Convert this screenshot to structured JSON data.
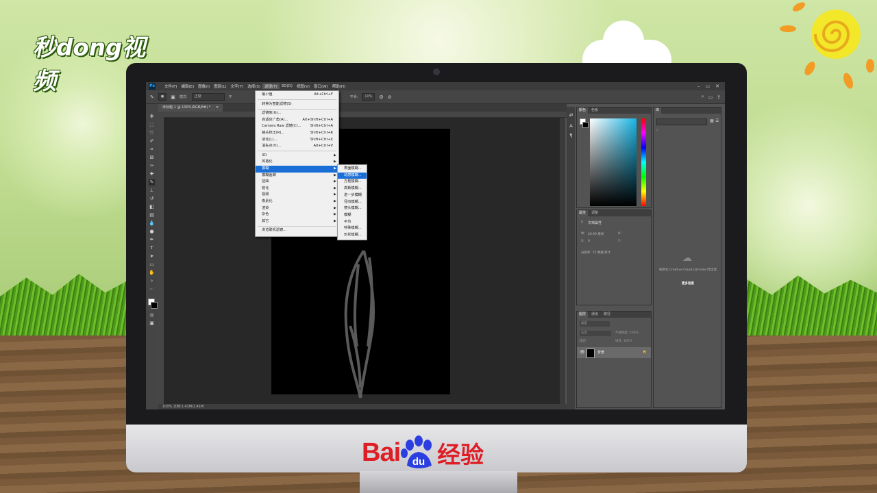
{
  "watermark_logo": "秒dong视频",
  "footer_logo": {
    "bai": "Bai",
    "du": "du",
    "jingyan": "经验",
    "brand_color": "#de1d24"
  },
  "app": {
    "badge": "Ps",
    "menu": [
      "文件(F)",
      "编辑(E)",
      "图像(I)",
      "图层(L)",
      "文字(Y)",
      "选择(S)",
      "滤镜(T)",
      "3D(D)",
      "视图(V)",
      "窗口(W)",
      "帮助(H)"
    ],
    "active_menu_index": 6,
    "window_controls": [
      "–",
      "▭",
      "✕"
    ]
  },
  "options_bar": {
    "mode_label": "模式:",
    "mode_value": "正常",
    "opacity_label": "不",
    "flow_label": "平滑:",
    "flow_value": "10%"
  },
  "document": {
    "tab_title": "未标题-1 @ 100%(RGB/8#) *",
    "tab_close": "×",
    "status": "100%    文档:1.41M/1.41M"
  },
  "filter_menu": {
    "items": [
      {
        "label": "最小值",
        "shortcut": "Alt+Ctrl+F"
      },
      {
        "separator": true
      },
      {
        "label": "转换为智能滤镜(S)"
      },
      {
        "separator": true
      },
      {
        "label": "滤镜库(G)..."
      },
      {
        "label": "自适应广角(A)...",
        "shortcut": "Alt+Shift+Ctrl+A"
      },
      {
        "label": "Camera Raw 滤镜(C)...",
        "shortcut": "Shift+Ctrl+A"
      },
      {
        "label": "镜头校正(R)...",
        "shortcut": "Shift+Ctrl+R"
      },
      {
        "label": "液化(L)...",
        "shortcut": "Shift+Ctrl+X"
      },
      {
        "label": "消失点(V)...",
        "shortcut": "Alt+Ctrl+V"
      },
      {
        "separator": true
      },
      {
        "label": "3D",
        "submenu": true
      },
      {
        "label": "风格化",
        "submenu": true
      },
      {
        "label": "模糊",
        "submenu": true,
        "highlighted": true
      },
      {
        "label": "模糊画廊",
        "submenu": true
      },
      {
        "label": "扭曲",
        "submenu": true
      },
      {
        "label": "锐化",
        "submenu": true
      },
      {
        "label": "视频",
        "submenu": true
      },
      {
        "label": "像素化",
        "submenu": true
      },
      {
        "label": "渲染",
        "submenu": true
      },
      {
        "label": "杂色",
        "submenu": true
      },
      {
        "label": "其它",
        "submenu": true
      },
      {
        "separator": true
      },
      {
        "label": "浏览联机滤镜..."
      }
    ]
  },
  "blur_submenu": {
    "items": [
      {
        "label": "表面模糊..."
      },
      {
        "label": "动感模糊...",
        "highlighted": true
      },
      {
        "label": "方框模糊..."
      },
      {
        "label": "高斯模糊..."
      },
      {
        "label": "进一步模糊"
      },
      {
        "label": "径向模糊..."
      },
      {
        "label": "镜头模糊..."
      },
      {
        "label": "模糊"
      },
      {
        "label": "平均"
      },
      {
        "label": "特殊模糊..."
      },
      {
        "label": "形状模糊..."
      }
    ]
  },
  "color_panel": {
    "tabs": [
      "颜色",
      "色板"
    ]
  },
  "properties_panel": {
    "tabs": [
      "属性",
      "调整"
    ],
    "title": "文档属性",
    "w_label": "W:",
    "w_value": "20.99 厘米",
    "h_label": "H:",
    "x_label": "X:",
    "x_value": "0",
    "y_label": "Y:",
    "resolution": "分辨率: 72 像素/英寸"
  },
  "libraries_panel": {
    "tab": "库",
    "message": "初始化 Creative Cloud Libraries 时出现",
    "link": "更多信息"
  },
  "layers_panel": {
    "tabs": [
      "图层",
      "通道",
      "路径"
    ],
    "kind": "类型",
    "blend": "正常",
    "opacity": "不透明度: 100%",
    "lock": "锁定:",
    "fill": "填充: 100%",
    "layer_name": "背景"
  }
}
